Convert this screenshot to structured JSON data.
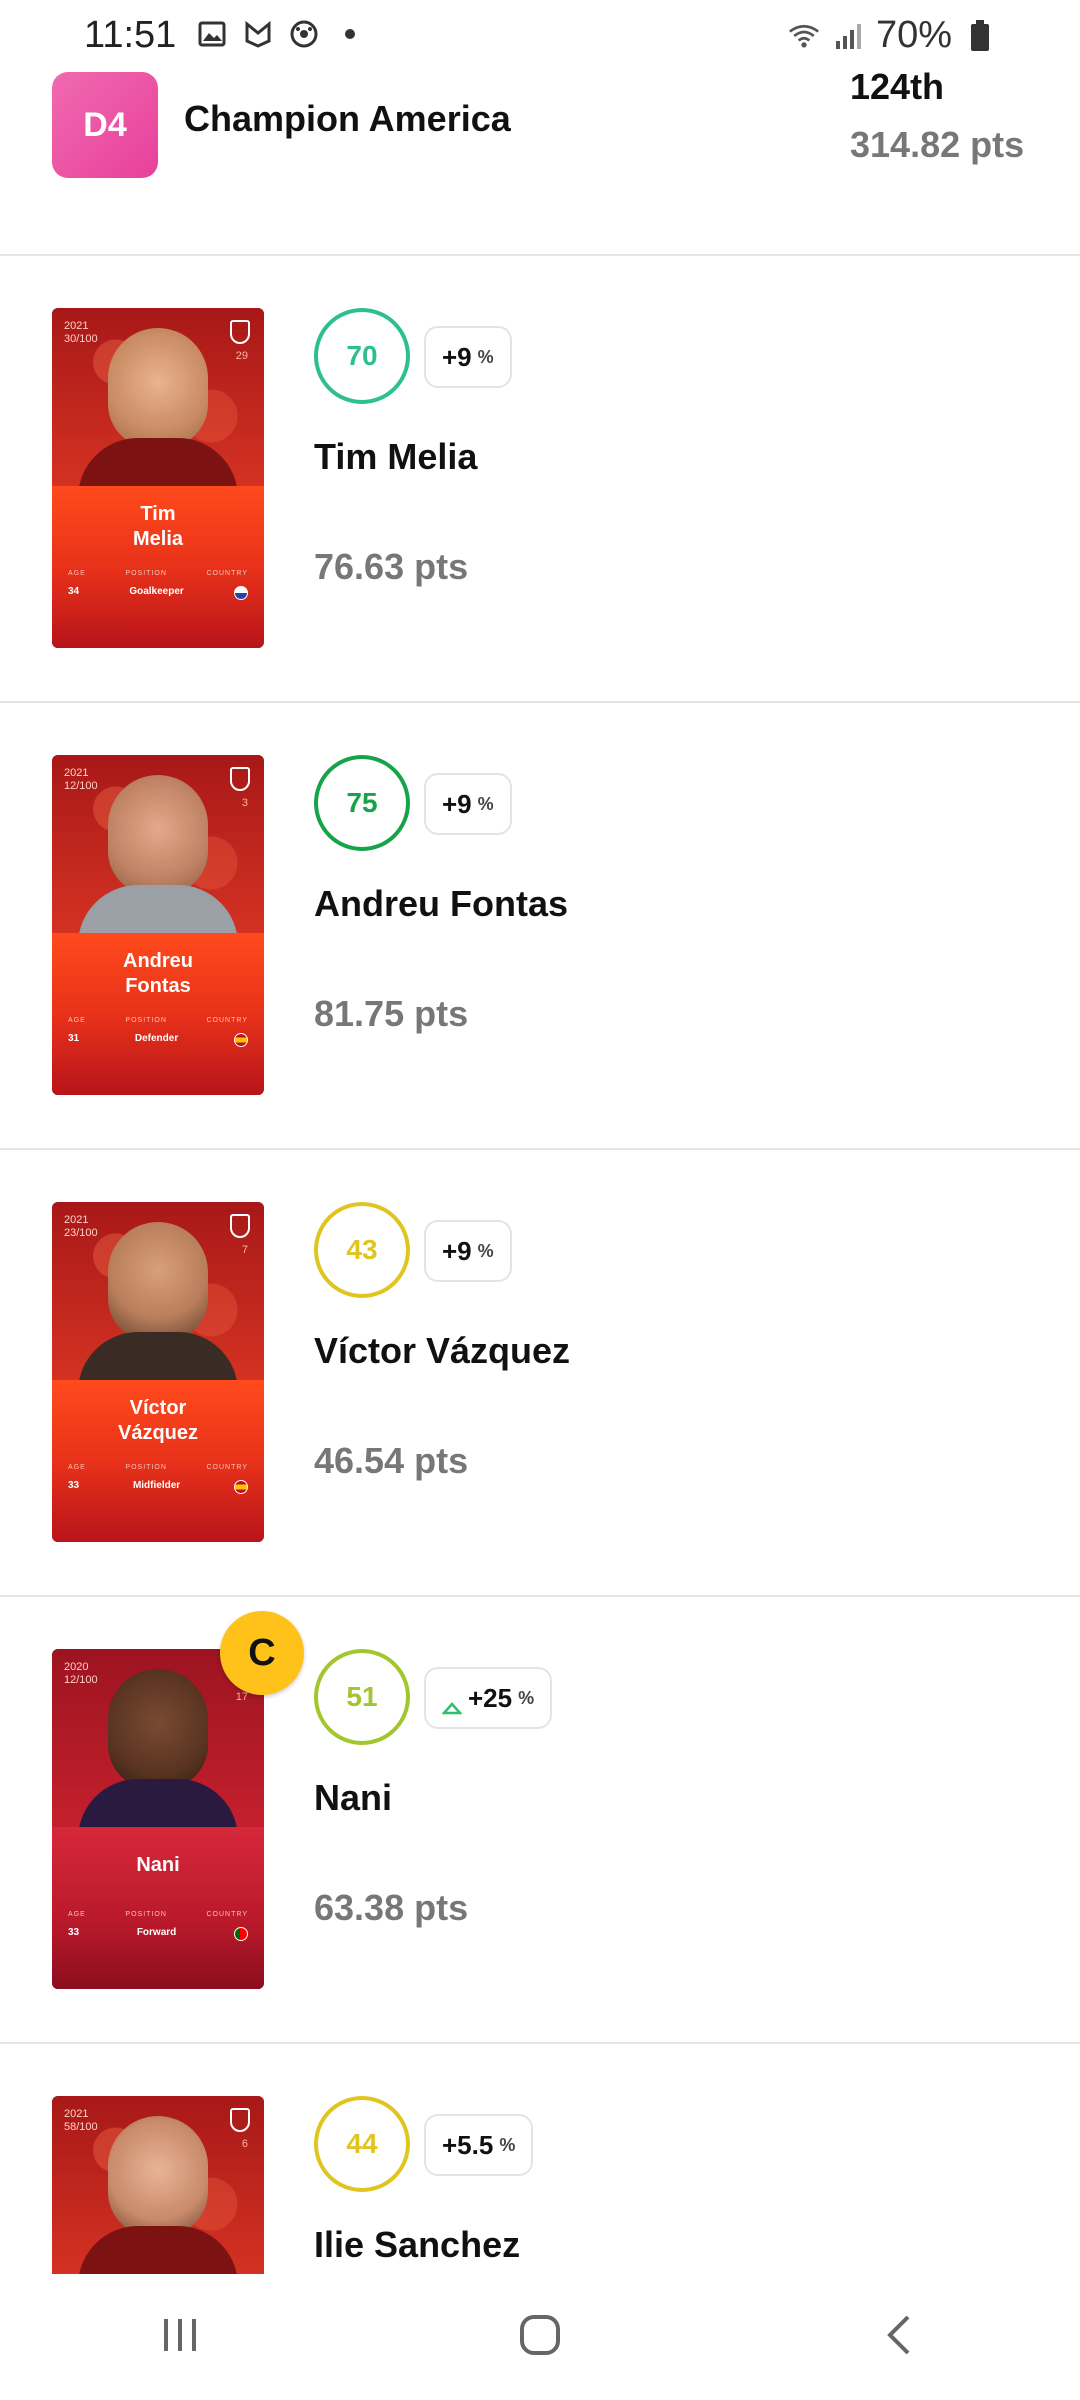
{
  "status_bar": {
    "time": "11:51",
    "battery": "70%",
    "icons": [
      "image-icon",
      "nfc-icon",
      "soccer-ball-icon",
      "dot-icon",
      "wifi-icon",
      "signal-icon",
      "battery-icon"
    ]
  },
  "league": {
    "division": "D4",
    "name": "Champion America",
    "rank": "124th",
    "total_points": "314.82 pts",
    "badge_color": "#ec4f9f"
  },
  "card_labels": {
    "age": "AGE",
    "position": "POSITION",
    "country": "COUNTRY"
  },
  "players": [
    {
      "name": "Tim Melia",
      "card_first": "Tim",
      "card_last": "Melia",
      "edition_year": "2021",
      "edition_serial": "30/100",
      "jersey": "29",
      "age": "34",
      "position": "Goalkeeper",
      "score": "70",
      "score_color": "#2ebf91",
      "bonus": "+9",
      "bonus_unit": "%",
      "points": "76.63 pts",
      "captain": false
    },
    {
      "name": "Andreu Fontas",
      "card_first": "Andreu",
      "card_last": "Fontas",
      "edition_year": "2021",
      "edition_serial": "12/100",
      "jersey": "3",
      "age": "31",
      "position": "Defender",
      "score": "75",
      "score_color": "#16a34a",
      "bonus": "+9",
      "bonus_unit": "%",
      "points": "81.75 pts",
      "captain": false
    },
    {
      "name": "Víctor Vázquez",
      "card_first": "Víctor",
      "card_last": "Vázquez",
      "edition_year": "2021",
      "edition_serial": "23/100",
      "jersey": "7",
      "age": "33",
      "position": "Midfielder",
      "score": "43",
      "score_color": "#e0c521",
      "bonus": "+9",
      "bonus_unit": "%",
      "points": "46.54 pts",
      "captain": false
    },
    {
      "name": "Nani",
      "card_first": "Nani",
      "card_last": "",
      "edition_year": "2020",
      "edition_serial": "12/100",
      "jersey": "17",
      "age": "33",
      "position": "Forward",
      "score": "51",
      "score_color": "#a3c62e",
      "bonus": "+25",
      "bonus_unit": "%",
      "points": "63.38 pts",
      "captain": true,
      "captain_label": "C"
    },
    {
      "name": "Ilie Sanchez",
      "card_first": "",
      "card_last": "",
      "edition_year": "2021",
      "edition_serial": "58/100",
      "jersey": "6",
      "age": "",
      "position": "",
      "score": "44",
      "score_color": "#e0c521",
      "bonus": "+5.5",
      "bonus_unit": "%",
      "points": "",
      "captain": false
    }
  ],
  "nav": [
    "recents-icon",
    "home-icon",
    "back-icon"
  ]
}
